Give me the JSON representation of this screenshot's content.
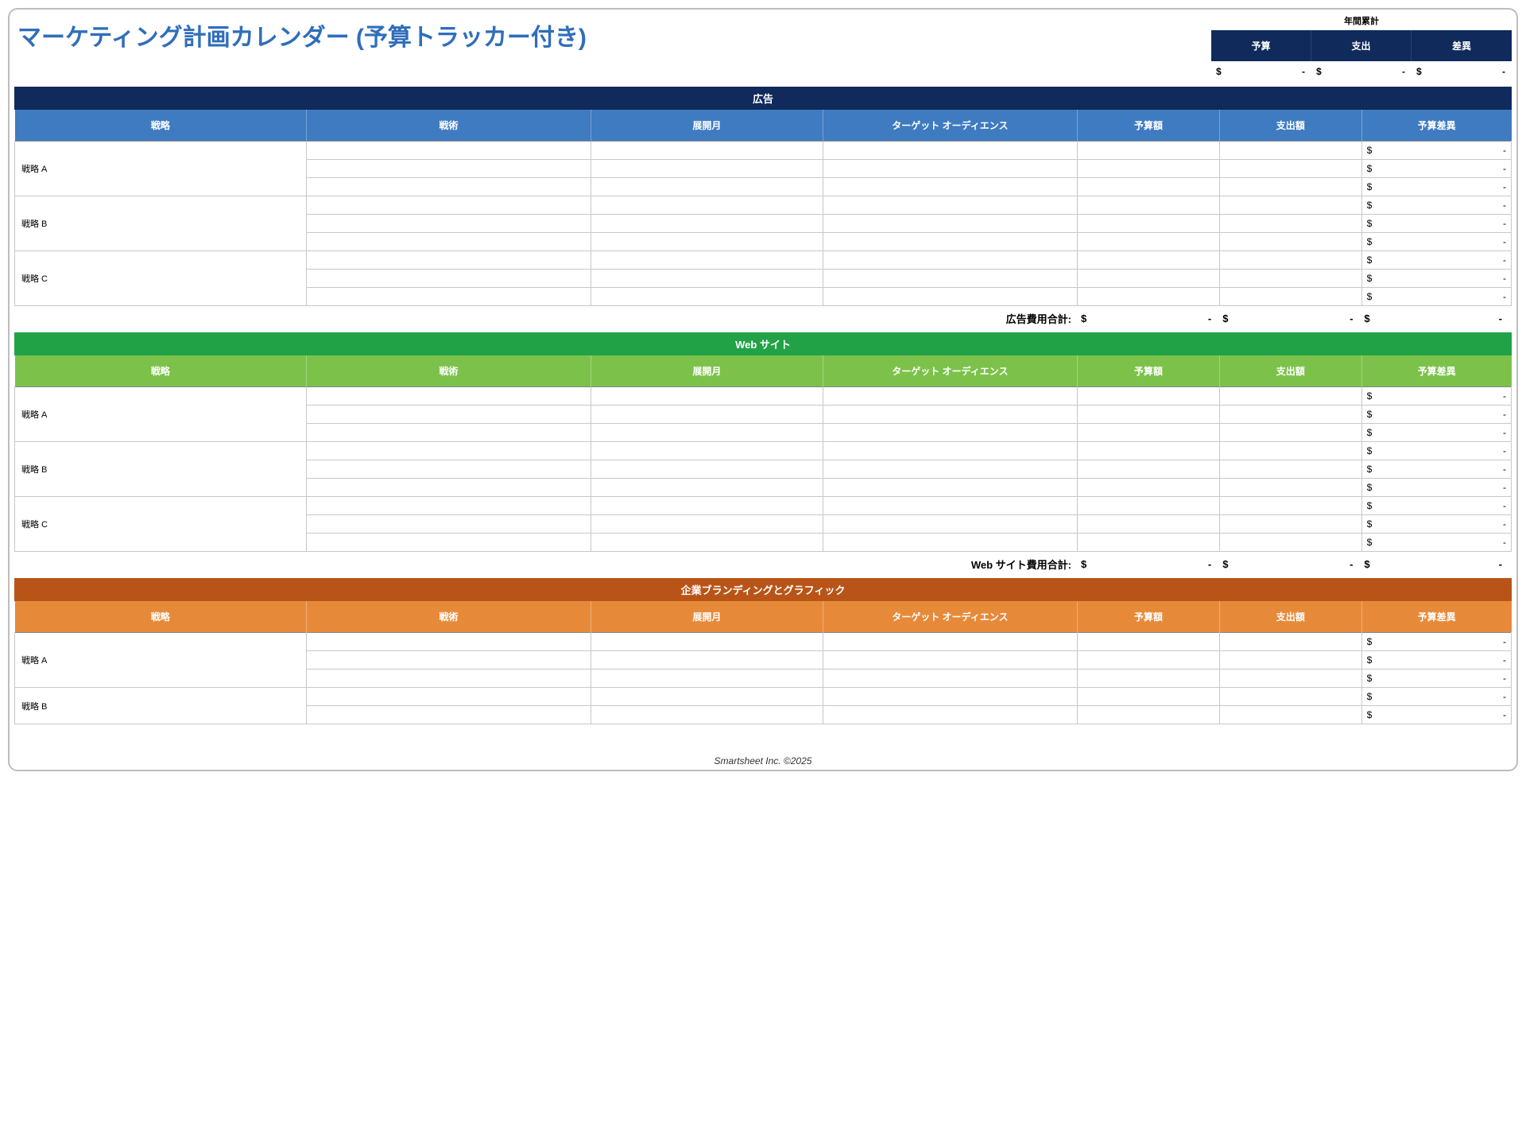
{
  "title": "マーケティング計画カレンダー (予算トラッカー付き)",
  "ytd": {
    "label": "年間累計",
    "cols": [
      "予算",
      "支出",
      "差異"
    ],
    "vals": [
      {
        "sym": "$",
        "val": "-"
      },
      {
        "sym": "$",
        "val": "-"
      },
      {
        "sym": "$",
        "val": "-"
      }
    ]
  },
  "columns": [
    "戦略",
    "戦術",
    "展開月",
    "ターゲット オーディエンス",
    "予算額",
    "支出額",
    "予算差異"
  ],
  "sections": [
    {
      "id": "advertising",
      "title": "広告",
      "titleClass": "navy",
      "headClass": "blue",
      "subtotal_label": "広告費用合計:",
      "strategies": [
        "戦略 A",
        "戦略 B",
        "戦略 C"
      ],
      "subtotal": [
        {
          "sym": "$",
          "val": "-"
        },
        {
          "sym": "$",
          "val": "-"
        },
        {
          "sym": "$",
          "val": "-"
        }
      ],
      "variance_cell": {
        "sym": "$",
        "val": "-"
      },
      "full": true
    },
    {
      "id": "website",
      "title": "Web サイト",
      "titleClass": "green",
      "headClass": "lgreen",
      "subtotal_label": "Web サイト費用合計:",
      "strategies": [
        "戦略 A",
        "戦略 B",
        "戦略 C"
      ],
      "subtotal": [
        {
          "sym": "$",
          "val": "-"
        },
        {
          "sym": "$",
          "val": "-"
        },
        {
          "sym": "$",
          "val": "-"
        }
      ],
      "variance_cell": {
        "sym": "$",
        "val": "-"
      },
      "full": true
    },
    {
      "id": "branding",
      "title": "企業ブランディングとグラフィック",
      "titleClass": "rust",
      "headClass": "orange",
      "subtotal_label": "",
      "strategies": [
        "戦略 A",
        "戦略 B"
      ],
      "subtotal": [],
      "variance_cell": {
        "sym": "$",
        "val": "-"
      },
      "full": false,
      "rows_for_last": 2
    }
  ],
  "footer": "Smartsheet Inc. ©2025"
}
